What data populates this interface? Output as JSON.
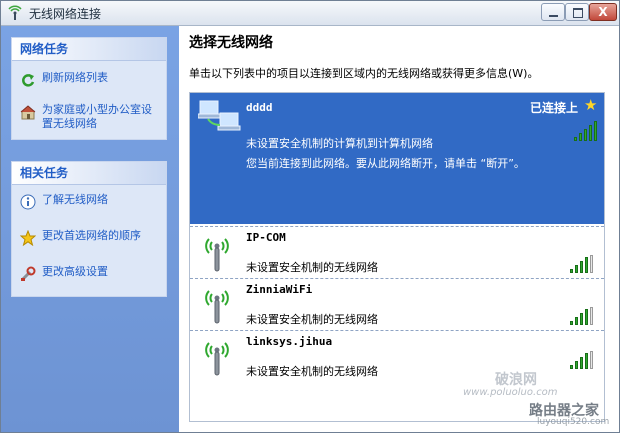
{
  "window": {
    "title": "无线网络连接",
    "close_glyph": "X"
  },
  "left": {
    "network_tasks": {
      "header": "网络任务",
      "items": [
        {
          "label": "刷新网络列表",
          "icon": "refresh-icon"
        },
        {
          "label": "为家庭或小型办公室设置无线网络",
          "icon": "setup-network-icon"
        }
      ]
    },
    "related_tasks": {
      "header": "相关任务",
      "items": [
        {
          "label": "了解无线网络",
          "icon": "info-icon"
        },
        {
          "label": "更改首选网络的顺序",
          "icon": "star-icon"
        },
        {
          "label": "更改高级设置",
          "icon": "settings-icon"
        }
      ]
    }
  },
  "main": {
    "heading": "选择无线网络",
    "instruction": "单击以下列表中的项目以连接到区域内的无线网络或获得更多信息(W)。",
    "networks": [
      {
        "name": "dddd",
        "status": "已连接上",
        "desc": "未设置安全机制的计算机到计算机网络",
        "hint": "您当前连接到此网络。要从此网络断开，请单击 “断开”。",
        "signal_bars": 5,
        "selected": true,
        "type": "computer-to-computer"
      },
      {
        "name": "IP-COM",
        "desc": "未设置安全机制的无线网络",
        "signal_bars": 4,
        "type": "access-point"
      },
      {
        "name": "ZinniaWiFi",
        "desc": "未设置安全机制的无线网络",
        "signal_bars": 4,
        "type": "access-point"
      },
      {
        "name": "linksys.jihua",
        "desc": "未设置安全机制的无线网络",
        "signal_bars": 4,
        "type": "access-point"
      }
    ]
  },
  "watermark": {
    "line1": "破浪网",
    "line2": "www.poluoluo.com",
    "line3": "路由器之家",
    "line4": "luyouqi520.com"
  },
  "colors": {
    "selection": "#316ac5",
    "task_link": "#215dc6",
    "signal": "#2fa82f"
  }
}
